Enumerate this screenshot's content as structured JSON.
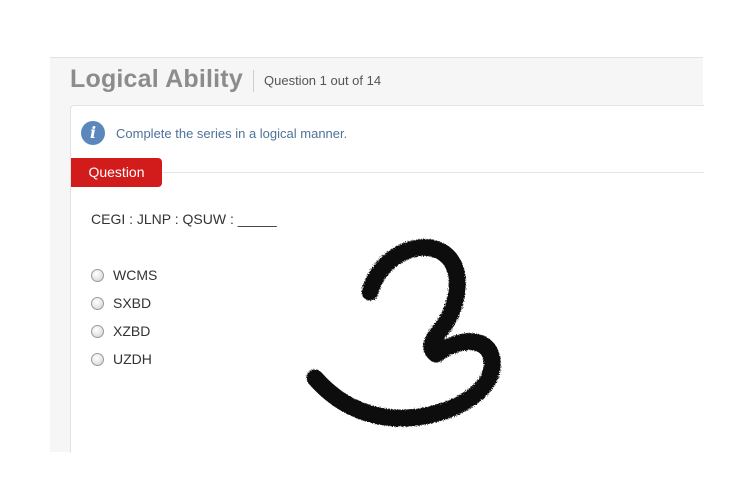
{
  "header": {
    "title": "Logical Ability",
    "counter": "Question 1 out of 14"
  },
  "info": {
    "icon": "info-icon",
    "instruction": "Complete the series in a logical manner."
  },
  "question": {
    "tab_label": "Question",
    "text": "CEGI : JLNP : QSUW : _____"
  },
  "options": [
    {
      "label": "WCMS",
      "selected": false
    },
    {
      "label": "SXBD",
      "selected": false
    },
    {
      "label": "XZBD",
      "selected": false
    },
    {
      "label": "UZDH",
      "selected": false
    }
  ],
  "colors": {
    "question_tab": "#d21b1b",
    "info_icon": "#5b87bd",
    "instruction_text": "#4f7297",
    "title": "#8c8c8c"
  }
}
